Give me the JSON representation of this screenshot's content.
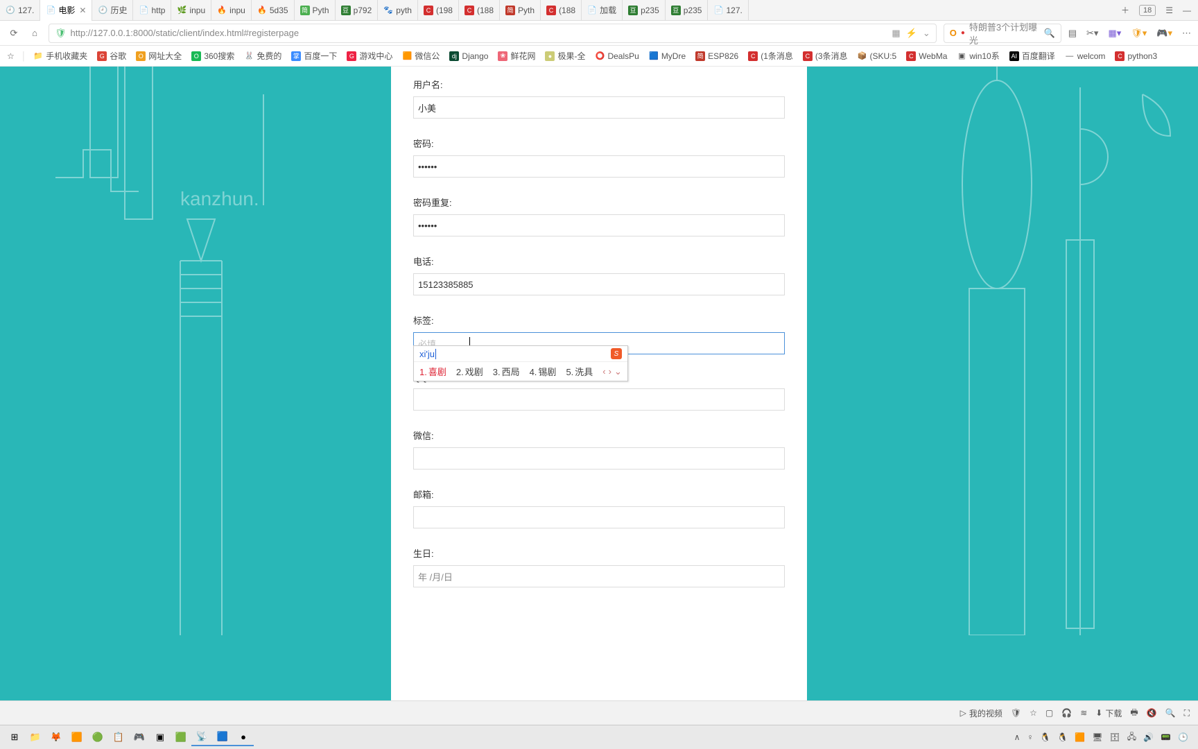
{
  "tabs": [
    {
      "label": "127.",
      "fav": "🕘"
    },
    {
      "label": "电影",
      "fav": "📄",
      "active": true
    },
    {
      "label": "历史",
      "fav": "🕘"
    },
    {
      "label": "http",
      "fav": "📄"
    },
    {
      "label": "inpu",
      "fav": "🌿"
    },
    {
      "label": "inpu",
      "fav": "🔥"
    },
    {
      "label": "5d35",
      "fav": "🔥"
    },
    {
      "label": "Pyth",
      "fav": "简",
      "favcolor": "#4caf50"
    },
    {
      "label": "p792",
      "fav": "豆",
      "favcolor": "#2e7d32"
    },
    {
      "label": "pyth",
      "fav": "🐾"
    },
    {
      "label": "(198",
      "fav": "C",
      "favcolor": "#d32f2f"
    },
    {
      "label": "(188",
      "fav": "C",
      "favcolor": "#d32f2f"
    },
    {
      "label": "Pyth",
      "fav": "简",
      "favcolor": "#c0392b"
    },
    {
      "label": "(188",
      "fav": "C",
      "favcolor": "#d32f2f"
    },
    {
      "label": "加载",
      "fav": "📄"
    },
    {
      "label": "p235",
      "fav": "豆",
      "favcolor": "#2e7d32"
    },
    {
      "label": "p235",
      "fav": "豆",
      "favcolor": "#2e7d32"
    },
    {
      "label": "127.",
      "fav": "📄"
    }
  ],
  "tab_overflow_count": "18",
  "address": {
    "url": "http://127.0.0.1:8000/static/client/index.html#registerpage",
    "search_placeholder": "特朗普3个计划曝光"
  },
  "bookmarks": [
    {
      "ic": "📁",
      "label": "手机收藏夹"
    },
    {
      "ic": "G",
      "label": "谷歌",
      "color": "#db4437"
    },
    {
      "ic": "O",
      "label": "网址大全",
      "color": "#f0a020"
    },
    {
      "ic": "O",
      "label": "360搜索",
      "color": "#19b955"
    },
    {
      "ic": "🐰",
      "label": "免费的"
    },
    {
      "ic": "掌",
      "label": "百度一下",
      "color": "#3b8cff"
    },
    {
      "ic": "G",
      "label": "游戏中心",
      "color": "#e24"
    },
    {
      "ic": "🟧",
      "label": "微信公"
    },
    {
      "ic": "dj",
      "label": "Django",
      "color": "#0c4b33"
    },
    {
      "ic": "❀",
      "label": "鲜花网",
      "color": "#e67"
    },
    {
      "ic": "●",
      "label": "极果-全",
      "color": "#cc7"
    },
    {
      "ic": "⭕",
      "label": "DealsPu"
    },
    {
      "ic": "🟦",
      "label": "MyDre"
    },
    {
      "ic": "简",
      "label": "ESP826",
      "color": "#c0392b"
    },
    {
      "ic": "C",
      "label": "(1条消息",
      "color": "#d32f2f"
    },
    {
      "ic": "C",
      "label": "(3条消息",
      "color": "#d32f2f"
    },
    {
      "ic": "📦",
      "label": "(SKU:5"
    },
    {
      "ic": "C",
      "label": "WebMa",
      "color": "#d32f2f"
    },
    {
      "ic": "▣",
      "label": "win10系"
    },
    {
      "ic": "AI",
      "label": "百度翻译",
      "color": "#000"
    },
    {
      "ic": "—",
      "label": "welcom"
    },
    {
      "ic": "C",
      "label": "python3",
      "color": "#d32f2f"
    }
  ],
  "bg_text": "kanzhun.",
  "form": {
    "username": {
      "label": "用户名:",
      "value": "小美"
    },
    "password": {
      "label": "密码:",
      "value": "••••••"
    },
    "password2": {
      "label": "密码重复:",
      "value": "••••••"
    },
    "phone": {
      "label": "电话:",
      "value": "15123385885"
    },
    "tags": {
      "label": "标签:",
      "placeholder": "必填"
    },
    "qq": {
      "label": "QQ:",
      "value": ""
    },
    "wechat": {
      "label": "微信:",
      "value": ""
    },
    "email": {
      "label": "邮箱:",
      "value": ""
    },
    "birthday": {
      "label": "生日:",
      "value": "年 /月/日"
    }
  },
  "ime": {
    "composition": "xi'ju",
    "candidates": [
      {
        "n": "1.",
        "w": "喜剧",
        "sel": true
      },
      {
        "n": "2.",
        "w": "戏剧"
      },
      {
        "n": "3.",
        "w": "西局"
      },
      {
        "n": "4.",
        "w": "锡剧"
      },
      {
        "n": "5.",
        "w": "洗具"
      }
    ]
  },
  "status": {
    "video": "我的视频",
    "download": "下载"
  },
  "taskbar_icons": [
    "⊞",
    "📁",
    "🦊",
    "🟧",
    "🟢",
    "📋",
    "🎮",
    "▣",
    "🟩",
    "📡",
    "🟦",
    "●"
  ],
  "tray_icons": [
    "∧",
    "♀",
    "🐧",
    "🐧",
    "🟧",
    "🖥",
    "🗄",
    "🖧",
    "🔊",
    "📟",
    "🕒"
  ]
}
